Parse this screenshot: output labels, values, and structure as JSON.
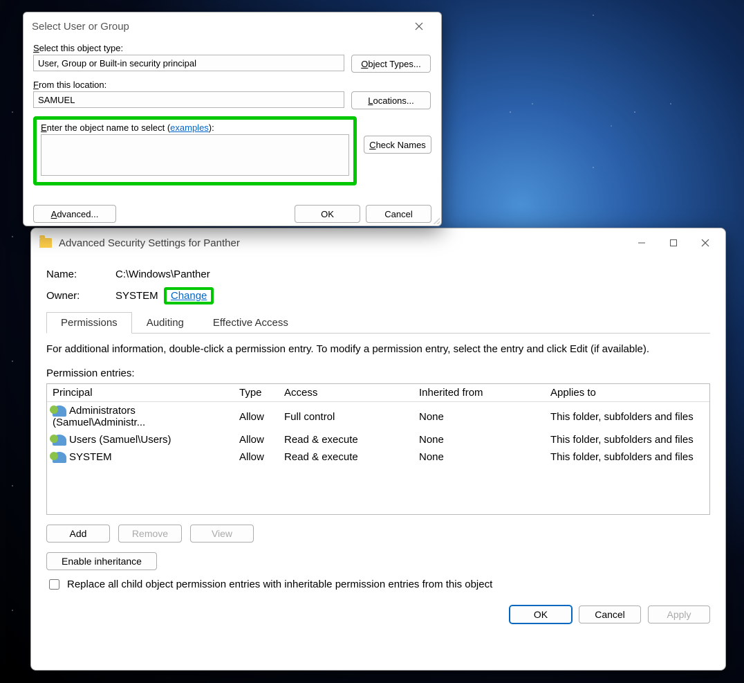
{
  "dlg1": {
    "title": "Select User or Group",
    "objtype_label": "Select this object type:",
    "objtype_value": "User, Group or Built-in security principal",
    "objtypes_btn": "Object Types...",
    "location_label": "From this location:",
    "location_value": "SAMUEL",
    "locations_btn": "Locations...",
    "objname_label_pre": "Enter the object name to select (",
    "examples": "examples",
    "objname_label_post": "):",
    "objname_value": "",
    "checknames_btn": "Check Names",
    "advanced_btn": "Advanced...",
    "ok_btn": "OK",
    "cancel_btn": "Cancel"
  },
  "dlg2": {
    "title": "Advanced Security Settings for Panther",
    "name_label": "Name:",
    "name_value": "C:\\Windows\\Panther",
    "owner_label": "Owner:",
    "owner_value": "SYSTEM",
    "change": "Change",
    "tabs": {
      "permissions": "Permissions",
      "auditing": "Auditing",
      "effective": "Effective Access"
    },
    "desc": "For additional information, double-click a permission entry. To modify a permission entry, select the entry and click Edit (if available).",
    "entries_label": "Permission entries:",
    "headers": {
      "principal": "Principal",
      "type": "Type",
      "access": "Access",
      "inherited": "Inherited from",
      "applies": "Applies to"
    },
    "rows": [
      {
        "principal": "Administrators (Samuel\\Administr...",
        "type": "Allow",
        "access": "Full control",
        "inherited": "None",
        "applies": "This folder, subfolders and files"
      },
      {
        "principal": "Users (Samuel\\Users)",
        "type": "Allow",
        "access": "Read & execute",
        "inherited": "None",
        "applies": "This folder, subfolders and files"
      },
      {
        "principal": "SYSTEM",
        "type": "Allow",
        "access": "Read & execute",
        "inherited": "None",
        "applies": "This folder, subfolders and files"
      }
    ],
    "add_btn": "Add",
    "remove_btn": "Remove",
    "view_btn": "View",
    "enable_inh_btn": "Enable inheritance",
    "replace_chk": "Replace all child object permission entries with inheritable permission entries from this object",
    "ok_btn": "OK",
    "cancel_btn": "Cancel",
    "apply_btn": "Apply"
  },
  "highlight": {
    "color": "#00c800"
  }
}
